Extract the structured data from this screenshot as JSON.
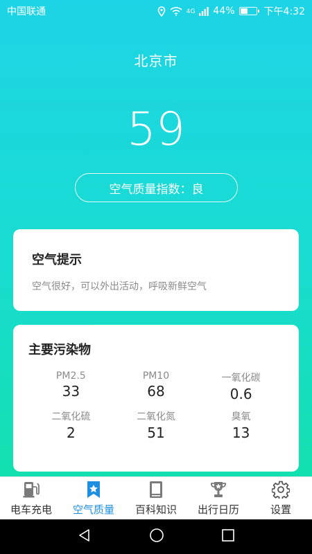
{
  "status_bar": {
    "carrier": "中国联通",
    "network": "4G",
    "battery": "44%",
    "time": "下午4:32"
  },
  "city": "北京市",
  "aqi": {
    "value": "59",
    "label": "空气质量指数：良"
  },
  "tip_card": {
    "title": "空气提示",
    "text": "空气很好，可以外出活动，呼吸新鲜空气"
  },
  "pollutants_card": {
    "title": "主要污染物",
    "items": [
      {
        "label": "PM2.5",
        "value": "33"
      },
      {
        "label": "PM10",
        "value": "68"
      },
      {
        "label": "一氧化碳",
        "value": "0.6"
      },
      {
        "label": "二氧化硫",
        "value": "2"
      },
      {
        "label": "二氧化氮",
        "value": "51"
      },
      {
        "label": "臭氧",
        "value": "13"
      }
    ]
  },
  "bottom_nav": [
    {
      "label": "电车充电",
      "icon": "charging-station-icon"
    },
    {
      "label": "空气质量",
      "icon": "star-bookmark-icon",
      "active": true
    },
    {
      "label": "百科知识",
      "icon": "book-icon"
    },
    {
      "label": "出行日历",
      "icon": "trophy-icon"
    },
    {
      "label": "设置",
      "icon": "gear-icon"
    }
  ],
  "colors": {
    "gradient_top": "#1dd4e6",
    "gradient_bottom": "#13e0b0",
    "active_nav": "#1e8fe0",
    "inactive_nav_icon": "#7a7a7a"
  }
}
